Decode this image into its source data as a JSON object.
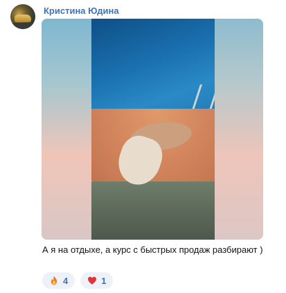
{
  "post": {
    "author": "Кристина Юдина",
    "caption": "А я на отдыхе, а курс с быстрых продаж разбирают )",
    "reactions": [
      {
        "icon": "fire-icon",
        "count": "4"
      },
      {
        "icon": "heart-icon",
        "count": "1"
      }
    ]
  },
  "colors": {
    "author_link": "#3e74b3",
    "reaction_bg": "#edf2f8",
    "heart": "#e0333b",
    "fire": "#f37a2a"
  }
}
